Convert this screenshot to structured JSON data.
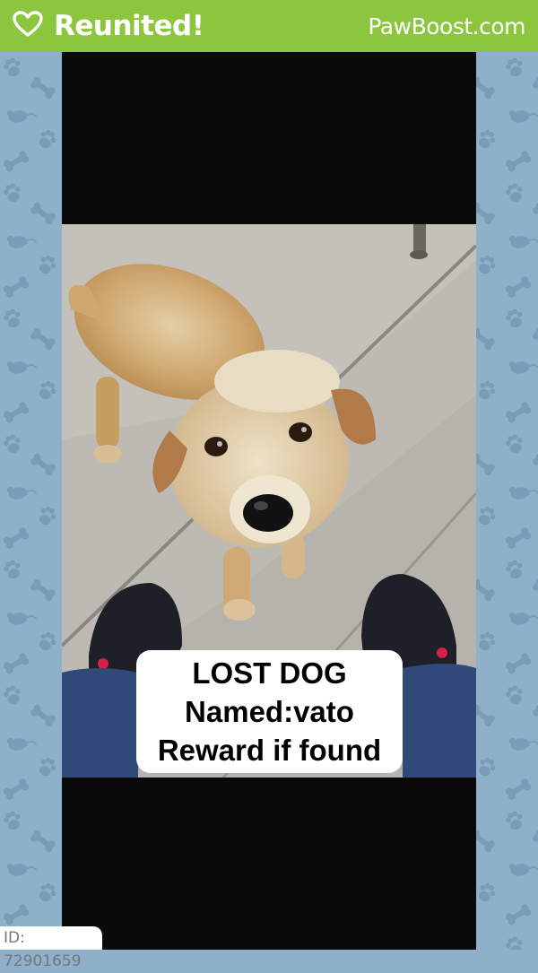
{
  "header": {
    "status_label": "Reunited!",
    "site_label": "PawBoost.com",
    "icon": "heart-icon",
    "bar_color": "#8cc63e"
  },
  "background": {
    "pattern_icons": [
      "paw-icon",
      "bone-icon",
      "mouse-icon",
      "fish-icon"
    ],
    "color": "#8fb0c9"
  },
  "photo": {
    "subject": "dog-photo",
    "caption_lines": [
      "LOST DOG",
      "Named:vato",
      "Reward if found"
    ]
  },
  "footer": {
    "id_label": "ID: 72901659"
  }
}
